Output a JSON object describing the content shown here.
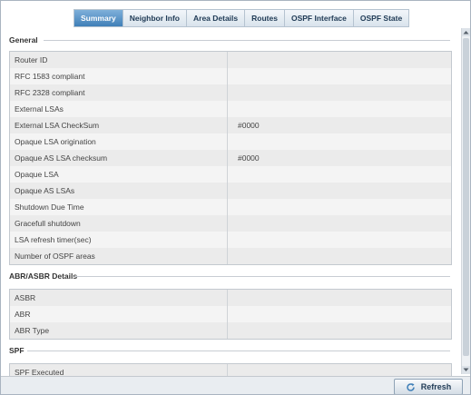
{
  "tabs": [
    {
      "label": "Summary",
      "active": true
    },
    {
      "label": "Neighbor Info",
      "active": false
    },
    {
      "label": "Area Details",
      "active": false
    },
    {
      "label": "Routes",
      "active": false
    },
    {
      "label": "OSPF Interface",
      "active": false
    },
    {
      "label": "OSPF State",
      "active": false
    }
  ],
  "general": {
    "title": "General",
    "rows": [
      {
        "label": "Router ID",
        "value": ""
      },
      {
        "label": "RFC 1583 compliant",
        "value": ""
      },
      {
        "label": "RFC 2328 compliant",
        "value": ""
      },
      {
        "label": "External LSAs",
        "value": ""
      },
      {
        "label": "External LSA CheckSum",
        "value": "#0000"
      },
      {
        "label": "Opaque LSA origination",
        "value": ""
      },
      {
        "label": "Opaque AS LSA checksum",
        "value": "#0000"
      },
      {
        "label": "Opaque LSA",
        "value": ""
      },
      {
        "label": "Opaque AS LSAs",
        "value": ""
      },
      {
        "label": "Shutdown Due Time",
        "value": ""
      },
      {
        "label": "Gracefull shutdown",
        "value": ""
      },
      {
        "label": "LSA refresh timer(sec)",
        "value": ""
      },
      {
        "label": "Number of OSPF areas",
        "value": ""
      }
    ]
  },
  "abr": {
    "title": "ABR/ASBR Details",
    "rows": [
      {
        "label": "ASBR",
        "value": ""
      },
      {
        "label": "ABR",
        "value": ""
      },
      {
        "label": "ABR Type",
        "value": ""
      }
    ]
  },
  "spf": {
    "title": "SPF",
    "rows": [
      {
        "label": "SPF Executed",
        "value": ""
      }
    ]
  },
  "footer": {
    "refresh_label": "Refresh"
  },
  "colors": {
    "tab_active": "#3f7fb8",
    "tab_text": "#1f3a55",
    "row_bg": "#ebebeb",
    "border": "#c3c9cf"
  }
}
